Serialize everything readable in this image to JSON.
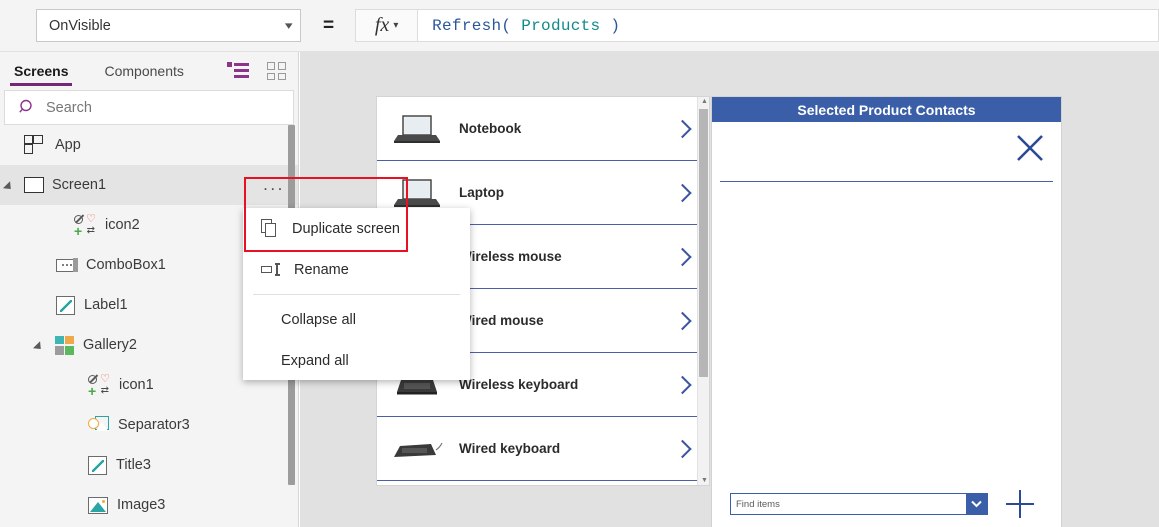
{
  "formula_bar": {
    "property": "OnVisible",
    "equals": "=",
    "fx_label": "fx",
    "formula_fn": "Refresh(",
    "formula_table": "Products",
    "formula_close": ")"
  },
  "sidebar": {
    "tabs": [
      {
        "label": "Screens",
        "active": true
      },
      {
        "label": "Components",
        "active": false
      }
    ],
    "view_icons": [
      {
        "name": "tree-view-icon",
        "active": true
      },
      {
        "name": "thumbnail-view-icon",
        "active": false
      }
    ],
    "search": {
      "placeholder": "Search",
      "value": ""
    },
    "tree": [
      {
        "label": "App",
        "level": 0,
        "icon": "app-icon"
      },
      {
        "label": "Screen1",
        "level": 0,
        "icon": "screen-icon",
        "selected": true,
        "expanded": true
      },
      {
        "label": "icon2",
        "level": 1,
        "icon": "icon-control-icon"
      },
      {
        "label": "ComboBox1",
        "level": 1,
        "icon": "combobox-icon"
      },
      {
        "label": "Label1",
        "level": 1,
        "icon": "label-icon"
      },
      {
        "label": "Gallery2",
        "level": 1,
        "icon": "gallery-icon",
        "expanded": true
      },
      {
        "label": "icon1",
        "level": 2,
        "icon": "icon-control-icon"
      },
      {
        "label": "Separator3",
        "level": 2,
        "icon": "separator-icon"
      },
      {
        "label": "Title3",
        "level": 2,
        "icon": "label-icon"
      },
      {
        "label": "Image3",
        "level": 2,
        "icon": "image-icon"
      }
    ],
    "overflow_label": "..."
  },
  "context_menu": {
    "items": [
      {
        "label": "Duplicate screen",
        "icon": "duplicate-icon",
        "highlighted": true
      },
      {
        "label": "Rename",
        "icon": "rename-icon"
      },
      {
        "label": "Collapse all",
        "icon": null
      },
      {
        "label": "Expand all",
        "icon": null
      }
    ]
  },
  "canvas": {
    "gallery": {
      "items": [
        {
          "name": "Notebook",
          "image": "notebook-thumbnail"
        },
        {
          "name": "Laptop",
          "image": "laptop-thumbnail"
        },
        {
          "name": "Wireless mouse",
          "image": "wireless-mouse-thumbnail"
        },
        {
          "name": "Wired mouse",
          "image": "wired-mouse-thumbnail"
        },
        {
          "name": "Wireless keyboard",
          "image": "wireless-keyboard-thumbnail"
        },
        {
          "name": "Wired keyboard",
          "image": "wired-keyboard-thumbnail"
        }
      ]
    },
    "right_panel": {
      "title": "Selected Product Contacts",
      "close_icon": "close-icon",
      "combobox_placeholder": "Find items",
      "combobox_value": "",
      "add_icon": "plus-icon"
    }
  },
  "colors": {
    "accent_purple": "#742774",
    "panel_blue": "#3a5fa8",
    "annotation_red": "#e81123",
    "canvas_gray": "#e1e1e1"
  }
}
